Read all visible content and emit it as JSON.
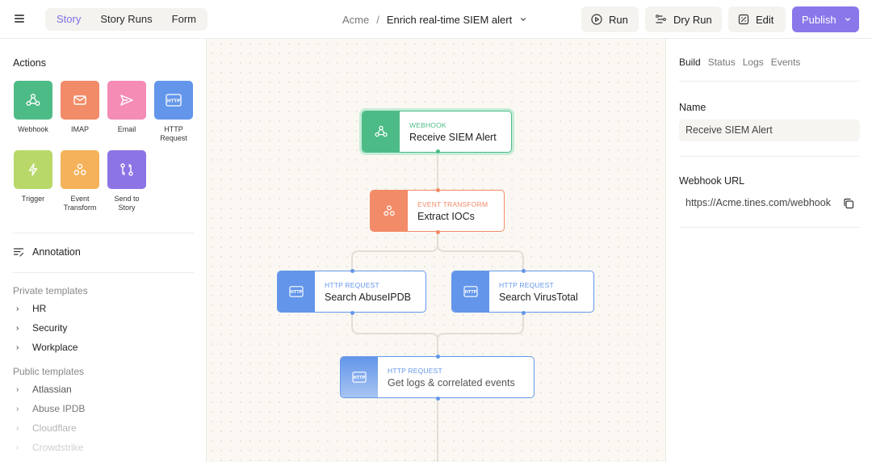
{
  "header": {
    "tabs": [
      {
        "label": "Story",
        "active": true
      },
      {
        "label": "Story Runs",
        "active": false
      },
      {
        "label": "Form",
        "active": false
      }
    ],
    "breadcrumb": {
      "org": "Acme",
      "separator": "/",
      "story": "Enrich real-time SIEM alert"
    },
    "buttons": {
      "run": "Run",
      "dry_run": "Dry Run",
      "edit": "Edit",
      "publish": "Publish"
    }
  },
  "sidebar": {
    "actions_title": "Actions",
    "actions": [
      {
        "label": "Webhook",
        "icon": "webhook-icon",
        "color": "#4dbb86"
      },
      {
        "label": "IMAP",
        "icon": "mail-icon",
        "color": "#f28b67"
      },
      {
        "label": "Email",
        "icon": "send-icon",
        "color": "#f48cb6"
      },
      {
        "label": "HTTP Request",
        "icon": "http-icon",
        "color": "#6396ea"
      },
      {
        "label": "Trigger",
        "icon": "lightning-icon",
        "color": "#b8d96a"
      },
      {
        "label": "Event Transform",
        "icon": "transform-icon",
        "color": "#f5b25a"
      },
      {
        "label": "Send to Story",
        "icon": "send-to-story-icon",
        "color": "#8d74e4"
      }
    ],
    "annotation": "Annotation",
    "private_templates_label": "Private templates",
    "private_templates": [
      "HR",
      "Security",
      "Workplace"
    ],
    "public_templates_label": "Public templates",
    "public_templates": [
      "Atlassian",
      "Abuse IPDB",
      "Cloudflare",
      "Crowdstrike"
    ]
  },
  "canvas": {
    "nodes": [
      {
        "type": "WEBHOOK",
        "name": "Receive SIEM Alert",
        "color": "#4dbb86"
      },
      {
        "type": "EVENT TRANSFORM",
        "name": "Extract IOCs",
        "color": "#f28b67"
      },
      {
        "type": "HTTP REQUEST",
        "name": "Search AbuseIPDB",
        "color": "#6396ea"
      },
      {
        "type": "HTTP REQUEST",
        "name": "Search VirusTotal",
        "color": "#6396ea"
      },
      {
        "type": "HTTP REQUEST",
        "name": "Get logs & correlated events",
        "color": "#6396ea"
      }
    ]
  },
  "panel": {
    "tabs": [
      {
        "label": "Build",
        "active": true
      },
      {
        "label": "Status",
        "active": false
      },
      {
        "label": "Logs",
        "active": false
      },
      {
        "label": "Events",
        "active": false
      }
    ],
    "name_label": "Name",
    "name_value": "Receive SIEM Alert",
    "webhook_label": "Webhook URL",
    "webhook_value": "https://Acme.tines.com/webhook"
  }
}
